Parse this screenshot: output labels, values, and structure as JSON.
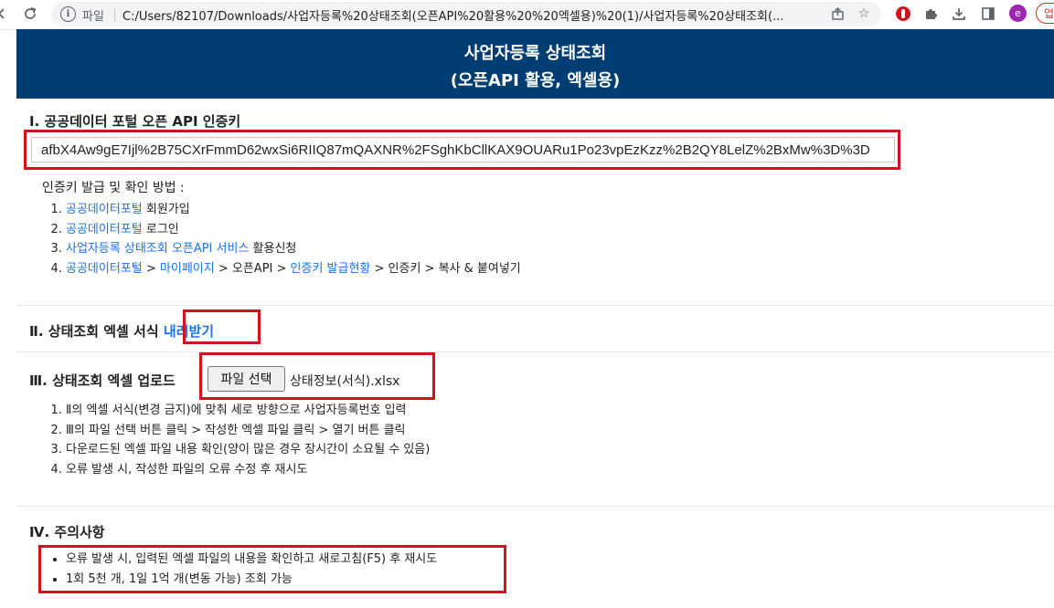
{
  "browser": {
    "scheme_label": "파일",
    "url": "C:/Users/82107/Downloads/사업자등록%20상태조회(오픈API%20활용%20%20엑셀용)%20(1)/사업자등록%20상태조회(...",
    "profile_initial": "e",
    "update_label": "업",
    "icons": [
      "back-icon",
      "reload-icon",
      "info-icon",
      "share-icon",
      "bookmark-star-icon",
      "shield-extension-icon",
      "puzzle-icon",
      "download-icon",
      "sidepanel-icon"
    ],
    "accent": "#1a73e8"
  },
  "header": {
    "title": "사업자등록 상태조회",
    "subtitle": "(오픈API 활용, 엑셀용)",
    "background": "#003d73"
  },
  "section1": {
    "title": "Ⅰ. 공공데이터 포털 오픈 API 인증키",
    "api_key": "afbX4Aw9gE7Ijl%2B75CXrFmmD62wxSi6RIIQ87mQAXNR%2FSghKbCllKAX9OUARu1Po23vpEzKzz%2B2QY8LelZ%2BxMw%3D%3D",
    "howto_label": "인증키 발급 및 확인 방법 :",
    "steps": {
      "s1_link": "공공데이터포털",
      "s1_text": " 회원가입",
      "s2_link": "공공데이터포털",
      "s2_text": " 로그인",
      "s3_link": "사업자등록 상태조회 오픈API 서비스",
      "s3_text": " 활용신청",
      "s4_link1": "공공데이터포털",
      "s4_sep1": " > ",
      "s4_link2": "마이페이지",
      "s4_mid": " > 오픈API > ",
      "s4_link3": "인증키 발급현황",
      "s4_text": " > 인증키 > 복사 & 붙여넣기"
    }
  },
  "section2": {
    "title": "Ⅱ. 상태조회 엑셀 서식",
    "download_link": "내려받기"
  },
  "section3": {
    "title": "Ⅲ. 상태조회 엑셀 업로드",
    "file_button": "파일 선택",
    "file_name": "상태정보(서식).xlsx",
    "steps": [
      "Ⅱ의 엑셀 서식(변경 금지)에 맞춰 세로 방향으로 사업자등록번호 입력",
      "Ⅲ의 파일 선택 버튼 클릭 > 작성한 엑셀 파일 클릭 > 열기 버튼 클릭",
      "다운로드된 엑셀 파일 내용 확인(양이 많은 경우 장시간이 소요될 수 있음)",
      "오류 발생 시, 작성한 파일의 오류 수정 후 재시도"
    ]
  },
  "section4": {
    "title": "Ⅳ. 주의사항",
    "notes": [
      "오류 발생 시, 입력된 엑셀 파일의 내용을 확인하고 새로고침(F5) 후 재시도",
      "1회 5천 개, 1일 1억 개(변동 가능) 조회 가능"
    ]
  },
  "highlight_color": "#d0131f"
}
